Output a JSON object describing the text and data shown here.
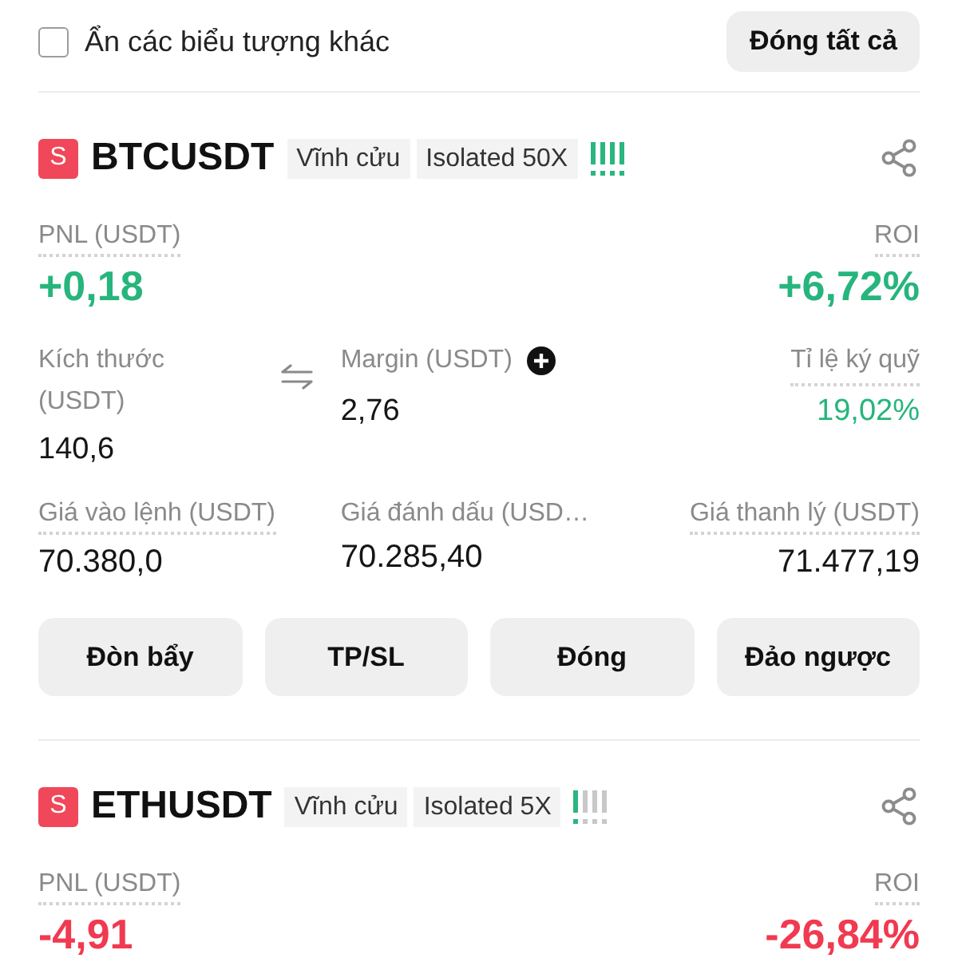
{
  "header": {
    "checkbox": {
      "label": "Ẩn các biểu tượng khác",
      "checked": false
    },
    "close_all_button": "Đóng tất cả"
  },
  "positions": [
    {
      "side_badge": "S",
      "symbol": "BTCUSDT",
      "tags": [
        "Vĩnh cửu",
        "Isolated 50X"
      ],
      "risk_bars": [
        {
          "on": true
        },
        {
          "on": true
        },
        {
          "on": true
        },
        {
          "on": true
        }
      ],
      "pnl": {
        "label": "PNL (USDT)",
        "tooltip": true,
        "value": "+0,18",
        "color": "#27b57d"
      },
      "roi": {
        "label": "ROI",
        "tooltip": true,
        "value": "+6,72%",
        "color": "#27b57d"
      },
      "size": {
        "label": "Kích thước (USDT)",
        "tooltip": false,
        "value": "140,6"
      },
      "margin": {
        "label": "Margin (USDT)",
        "tooltip": false,
        "value": "2,76"
      },
      "margin_ratio": {
        "label": "Tỉ lệ ký quỹ",
        "tooltip": true,
        "value": "19,02%",
        "color": "#27b57d"
      },
      "prices": [
        {
          "label": "Giá vào lệnh (USDT)",
          "tooltip": true,
          "value": "70.380,0"
        },
        {
          "label": "Giá đánh dấu (USD…",
          "tooltip": false,
          "value": "70.285,40"
        },
        {
          "label": "Giá thanh lý (USDT)",
          "tooltip": true,
          "value": "71.477,19"
        }
      ],
      "actions": [
        "Đòn bẩy",
        "TP/SL",
        "Đóng",
        "Đảo ngược"
      ]
    },
    {
      "side_badge": "S",
      "symbol": "ETHUSDT",
      "tags": [
        "Vĩnh cửu",
        "Isolated 5X"
      ],
      "risk_bars": [
        {
          "on": true
        },
        {
          "on": false
        },
        {
          "on": false
        },
        {
          "on": false
        }
      ],
      "pnl": {
        "label": "PNL (USDT)",
        "tooltip": true,
        "value": "-4,91",
        "color": "#f03a51"
      },
      "roi": {
        "label": "ROI",
        "tooltip": true,
        "value": "-26,84%",
        "color": "#f03a51"
      }
    }
  ]
}
